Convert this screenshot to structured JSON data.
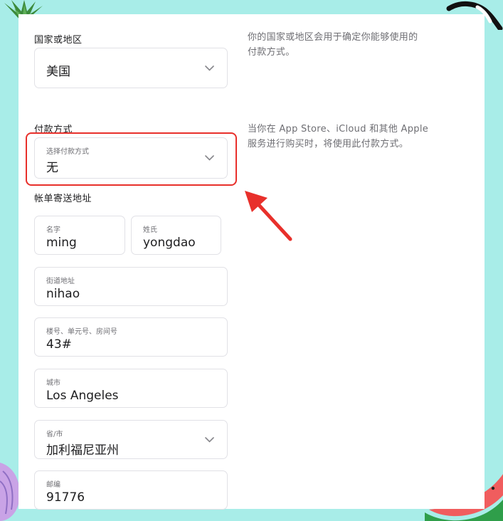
{
  "region": {
    "label": "国家或地区",
    "value": "美国",
    "description_line1": "你的国家或地区会用于确定你能够使用的",
    "description_line2": "付款方式。"
  },
  "payment": {
    "label": "付款方式",
    "field_label": "选择付款方式",
    "value": "无",
    "description_line1": "当你在 App Store、iCloud 和其他 Apple",
    "description_line2": "服务进行购买时，将使用此付款方式。"
  },
  "billing": {
    "heading": "帐单寄送地址",
    "first_name": {
      "label": "名字",
      "value": "ming"
    },
    "last_name": {
      "label": "姓氏",
      "value": "yongdao"
    },
    "street": {
      "label": "街道地址",
      "value": "nihao"
    },
    "unit": {
      "label": "楼号、单元号、房间号",
      "value": "43#"
    },
    "city": {
      "label": "城市",
      "value": "Los Angeles"
    },
    "state": {
      "label": "省/市",
      "value": "加利福尼亚州"
    },
    "zip": {
      "label": "邮编",
      "value": "91776"
    }
  },
  "colors": {
    "background": "#a8ede8",
    "highlight": "#e8302b",
    "field_border": "#e1e1e6"
  },
  "icons": [
    "chevron-down-icon",
    "red-arrow-annotation"
  ]
}
